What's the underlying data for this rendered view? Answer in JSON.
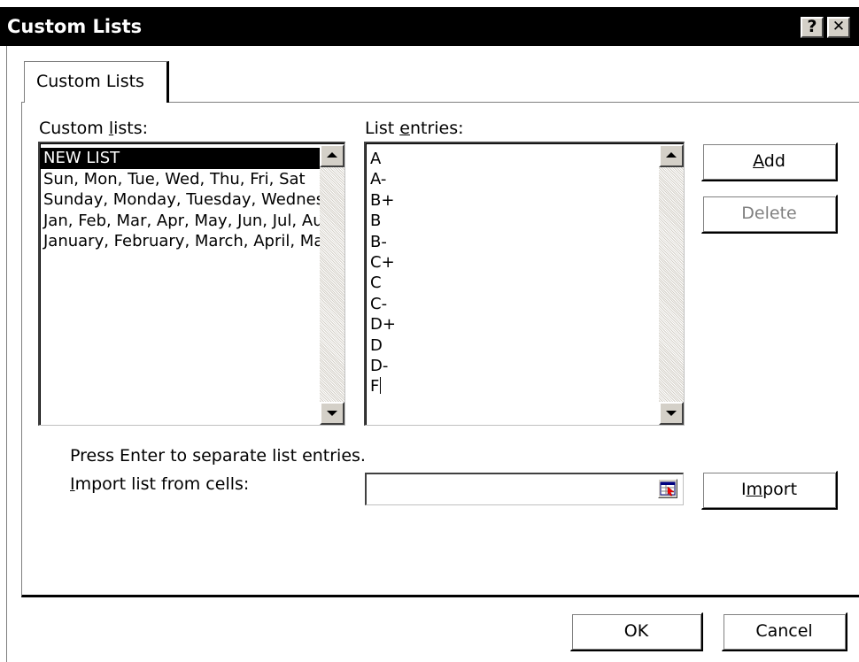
{
  "window": {
    "title": "Custom Lists",
    "help_glyph": "?",
    "close_glyph": "✕"
  },
  "tab": {
    "label": "Custom Lists"
  },
  "custom_lists": {
    "label_pre": "Custom ",
    "label_key": "l",
    "label_post": "ists:",
    "items": [
      "NEW LIST",
      "Sun, Mon, Tue, Wed, Thu, Fri, Sat",
      "Sunday, Monday, Tuesday, Wednesday, Thursday, Friday, Saturday",
      "Jan, Feb, Mar, Apr, May, Jun, Jul, Aug, Sep, Oct, Nov, Dec",
      "January, February, March, April, May, June, July, August, September, October, November, December"
    ],
    "selected_index": 0
  },
  "list_entries": {
    "label_pre": "List ",
    "label_key": "e",
    "label_post": "ntries:",
    "entries": [
      "A",
      "A-",
      "B+",
      "B",
      "B-",
      "C+",
      "C",
      "C-",
      "D+",
      "D",
      "D-",
      "F"
    ]
  },
  "buttons": {
    "add_key": "A",
    "add_rest": "dd",
    "delete": "Delete",
    "import_pre": "I",
    "import_key": "m",
    "import_post": "port",
    "ok": "OK",
    "cancel": "Cancel"
  },
  "hint": "Press Enter to separate list entries.",
  "import_cells": {
    "label_key": "I",
    "label_rest": "mport list from cells:",
    "value": ""
  },
  "colors": {
    "titlebar": "#000000",
    "selection": "#000000",
    "face": "#d4d0c8",
    "disabled_text": "#808080"
  }
}
